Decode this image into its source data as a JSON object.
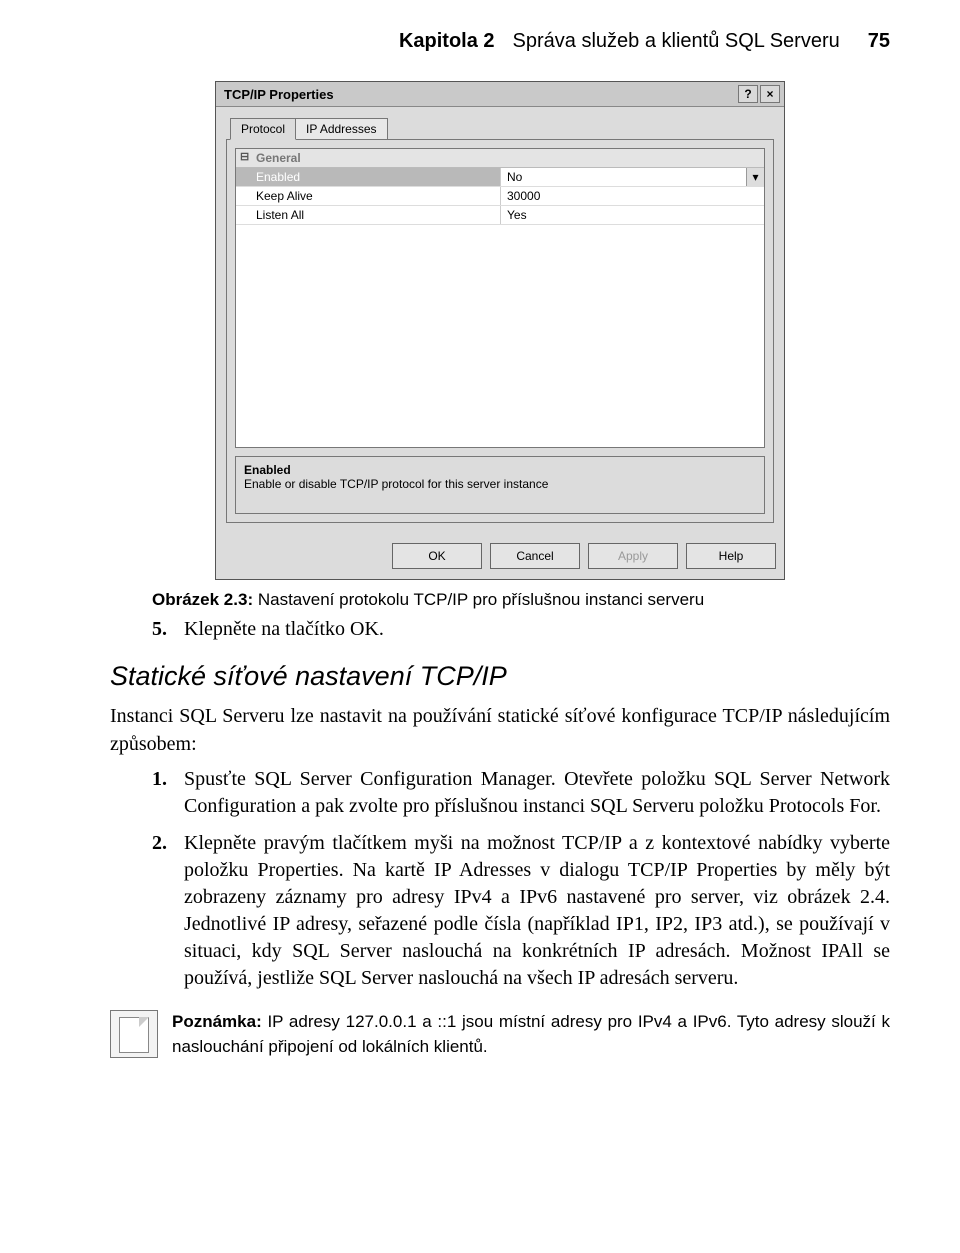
{
  "header": {
    "chapter": "Kapitola 2",
    "title": "Správa služeb a klientů SQL Serveru",
    "page": "75"
  },
  "dialog": {
    "title": "TCP/IP Properties",
    "help_glyph": "?",
    "close_glyph": "×",
    "tabs": {
      "protocol": "Protocol",
      "ip": "IP Addresses"
    },
    "section": "General",
    "rows": [
      {
        "name": "Enabled",
        "value": "No",
        "selected": true
      },
      {
        "name": "Keep Alive",
        "value": "30000",
        "selected": false
      },
      {
        "name": "Listen All",
        "value": "Yes",
        "selected": false
      }
    ],
    "desc": {
      "title": "Enabled",
      "text": "Enable or disable TCP/IP protocol for this server instance"
    },
    "buttons": {
      "ok": "OK",
      "cancel": "Cancel",
      "apply": "Apply",
      "help": "Help"
    },
    "chev": "▾"
  },
  "caption": {
    "label": "Obrázek 2.3:",
    "text": "Nastavení protokolu TCP/IP pro příslušnou instanci serveru"
  },
  "step5": {
    "num": "5.",
    "text": "Klepněte na tlačítko OK."
  },
  "heading": "Statické síťové nastavení TCP/IP",
  "intro": "Instanci SQL Serveru lze nastavit na používání statické síťové konfigurace TCP/IP následujícím způsobem:",
  "step1": {
    "num": "1.",
    "text": "Spusťte SQL Server Configuration Manager. Otevřete položku SQL Server Network Configuration a pak zvolte pro příslušnou instanci SQL Serveru položku Protocols For."
  },
  "step2": {
    "num": "2.",
    "text": "Klepněte pravým tlačítkem myši na možnost TCP/IP a z kontextové nabídky vyberte položku Properties. Na kartě IP Adresses v dialogu TCP/IP Properties by měly být zobrazeny záznamy pro adresy IPv4 a IPv6 nastavené pro server, viz obrázek 2.4. Jednotlivé IP adresy, seřazené podle čísla (například IP1, IP2, IP3 atd.), se používají v situaci, kdy SQL Server naslouchá na konkrétních IP adresách. Možnost IPAll se používá, jestliže SQL Server naslouchá na všech IP adresách serveru."
  },
  "note": {
    "label": "Poznámka:",
    "text": "IP adresy 127.0.0.1 a ::1 jsou místní adresy pro IPv4 a IPv6. Tyto adresy slouží k naslouchání připojení od lokálních klientů."
  }
}
